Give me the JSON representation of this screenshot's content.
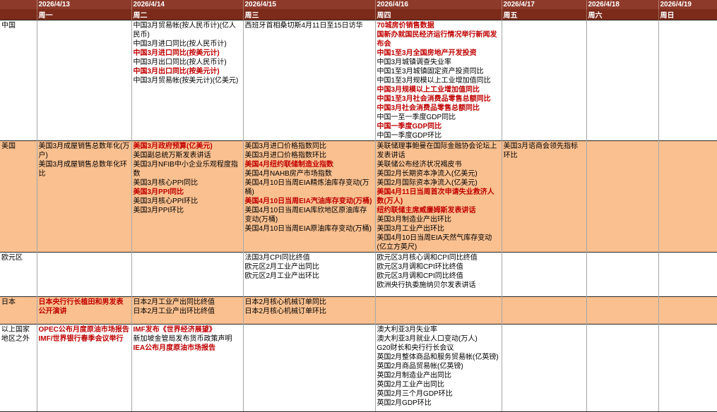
{
  "colors": {
    "header_date_bg": "#8E3A2B",
    "header_weekday_bg": "#7C2B1B",
    "header_text": "#FFFFFF",
    "highlight_text": "#C00000",
    "body_text": "#000000",
    "peach_row_bg": "#FAC090",
    "white_row_bg": "#FFFFFF"
  },
  "calendar": {
    "days": [
      {
        "date": "2026/4/13",
        "weekday": "周一"
      },
      {
        "date": "2026/4/14",
        "weekday": "周二"
      },
      {
        "date": "2026/4/15",
        "weekday": "周三"
      },
      {
        "date": "2026/4/16",
        "weekday": "周四"
      },
      {
        "date": "2026/4/17",
        "weekday": "周五"
      },
      {
        "date": "2026/4/18",
        "weekday": "周六"
      },
      {
        "date": "2026/4/19",
        "weekday": "周日"
      }
    ],
    "regions": [
      {
        "label": "中国",
        "bg": "white",
        "cells": [
          [],
          [
            {
              "text": "中国3月贸易帐(按人民币计)(亿人民币)",
              "highlight": false
            },
            {
              "text": "中国3月进口同比(按人民币计)",
              "highlight": false
            },
            {
              "text": "中国3月进口同比(按美元计)",
              "highlight": true
            },
            {
              "text": "中国3月出口同比(按人民币计)",
              "highlight": false
            },
            {
              "text": "中国3月出口同比(按美元计)",
              "highlight": true
            },
            {
              "text": "中国3月贸易帐(按美元计)(亿美元)",
              "highlight": false
            }
          ],
          [
            {
              "text": "西班牙首相桑切斯4月11日至15日访华",
              "highlight": false
            }
          ],
          [
            {
              "text": "70城房价销售数据",
              "highlight": true
            },
            {
              "text": "国新办就国民经济运行情况举行新闻发布会",
              "highlight": true
            },
            {
              "text": "中国1至3月全国房地产开发投资",
              "highlight": true
            },
            {
              "text": "中国3月城镇调查失业率",
              "highlight": false
            },
            {
              "text": "中国1至3月城镇固定资产投资同比",
              "highlight": false
            },
            {
              "text": "中国1至3月规模以上工业增加值同比",
              "highlight": false
            },
            {
              "text": "中国3月规模以上工业增加值同比",
              "highlight": true
            },
            {
              "text": "中国1至3月社会消费品零售总额同比",
              "highlight": true
            },
            {
              "text": "中国3月社会消费品零售总额同比",
              "highlight": true
            },
            {
              "text": "中国一至一季度GDP同比",
              "highlight": false
            },
            {
              "text": "中国一季度GDP同比",
              "highlight": true
            },
            {
              "text": "中国一季度GDP环比",
              "highlight": false
            }
          ],
          [],
          [],
          []
        ]
      },
      {
        "label": "美国",
        "bg": "peach",
        "cells": [
          [
            {
              "text": "美国3月成屋销售总数年化(万户)",
              "highlight": false
            },
            {
              "text": "美国3月成屋销售总数年化环比",
              "highlight": false
            }
          ],
          [
            {
              "text": "美国3月政府预算(亿美元)",
              "highlight": true
            },
            {
              "text": "美国副总统万斯发表讲话",
              "highlight": false
            },
            {
              "text": "美国3月NFIB中小企业乐观程度指数",
              "highlight": false
            },
            {
              "text": "美国3月核心PPI同比",
              "highlight": false
            },
            {
              "text": "美国3月PPI同比",
              "highlight": true
            },
            {
              "text": "美国3月核心PPI环比",
              "highlight": false
            },
            {
              "text": "美国3月PPI环比",
              "highlight": false
            }
          ],
          [
            {
              "text": "美国3月进口价格指数同比",
              "highlight": false
            },
            {
              "text": "美国3月进口价格指数环比",
              "highlight": false
            },
            {
              "text": "美国4月纽约联储制造业指数",
              "highlight": true
            },
            {
              "text": "美国4月NAHB房产市场指数",
              "highlight": false
            },
            {
              "text": "美国4月10日当周EIA精炼油库存变动(万桶)",
              "highlight": false
            },
            {
              "text": "美国4月10日当周EIA汽油库存变动(万桶)",
              "highlight": true
            },
            {
              "text": "美国4月10日当周EIA库欣地区原油库存变动(万桶)",
              "highlight": false
            },
            {
              "text": "美国4月10日当周EIA原油库存变动(万桶)",
              "highlight": false
            }
          ],
          [
            {
              "text": "美联储理事鲍曼在国际金融协会论坛上发表讲话",
              "highlight": false
            },
            {
              "text": "美联储公布经济状况褐皮书",
              "highlight": false
            },
            {
              "text": "美国2月长期资本净流入(亿美元)",
              "highlight": false
            },
            {
              "text": "美国2月国际资本净流入(亿美元)",
              "highlight": false
            },
            {
              "text": "美国4月11日当周首次申请失业救济人数(万人)",
              "highlight": true
            },
            {
              "text": "纽约联储主席威廉姆斯发表讲话",
              "highlight": true
            },
            {
              "text": "美国3月制造业产出环比",
              "highlight": false
            },
            {
              "text": "美国3月工业产出环比",
              "highlight": false
            },
            {
              "text": "美国4月10日当周EIA天然气库存变动(亿立方英尺)",
              "highlight": false
            }
          ],
          [
            {
              "text": "美国3月谘商会领先指标环比",
              "highlight": false
            }
          ],
          [],
          []
        ]
      },
      {
        "label": "欧元区",
        "bg": "white",
        "cells": [
          [],
          [],
          [
            {
              "text": "法国3月CPI同比终值",
              "highlight": false
            },
            {
              "text": "欧元区2月工业产出同比",
              "highlight": false
            },
            {
              "text": "欧元区2月工业产出环比",
              "highlight": false
            }
          ],
          [
            {
              "text": "欧元区3月核心调和CPI同比终值",
              "highlight": false
            },
            {
              "text": "欧元区3月调和CPI环比终值",
              "highlight": false
            },
            {
              "text": "欧元区3月调和CPI同比终值",
              "highlight": false
            },
            {
              "text": "欧洲央行执委施纳贝尔发表讲话",
              "highlight": false
            }
          ],
          [],
          [],
          []
        ]
      },
      {
        "label": "日本",
        "bg": "peach",
        "cells": [
          [
            {
              "text": "日本央行行长植田和男发表公开演讲",
              "highlight": true
            }
          ],
          [
            {
              "text": "日本2月工业产出同比终值",
              "highlight": false
            },
            {
              "text": "日本2月工业产出环比终值",
              "highlight": false
            }
          ],
          [
            {
              "text": "日本2月核心机械订单同比",
              "highlight": false
            },
            {
              "text": "日本2月核心机械订单环比",
              "highlight": false
            }
          ],
          [],
          [],
          [],
          []
        ]
      },
      {
        "label": "以上国家地区之外",
        "bg": "white",
        "cells": [
          [
            {
              "text": "OPEC公布月度原油市场报告",
              "highlight": true
            },
            {
              "text": "IMF/世界银行春季会议举行",
              "highlight": true
            }
          ],
          [
            {
              "text": "IMF发布《世界经济展望》",
              "highlight": true
            },
            {
              "text": "新加坡金管局发布货币政策声明",
              "highlight": false
            },
            {
              "text": "IEA公布月度原油市场报告",
              "highlight": true
            }
          ],
          [],
          [
            {
              "text": "澳大利亚3月失业率",
              "highlight": false
            },
            {
              "text": "澳大利亚3月就业人口变动(万人)",
              "highlight": false
            },
            {
              "text": "G20财长和央行行长会议",
              "highlight": false
            },
            {
              "text": "英国2月整体商品和服务贸易帐(亿英镑)",
              "highlight": false
            },
            {
              "text": "英国2月商品贸易帐(亿英镑)",
              "highlight": false
            },
            {
              "text": "英国2月制造业产出同比",
              "highlight": false
            },
            {
              "text": "英国2月工业产出同比",
              "highlight": false
            },
            {
              "text": "英国2月三个月GDP环比",
              "highlight": false
            },
            {
              "text": "英国2月GDP环比",
              "highlight": false
            }
          ],
          [],
          [],
          []
        ]
      }
    ]
  }
}
